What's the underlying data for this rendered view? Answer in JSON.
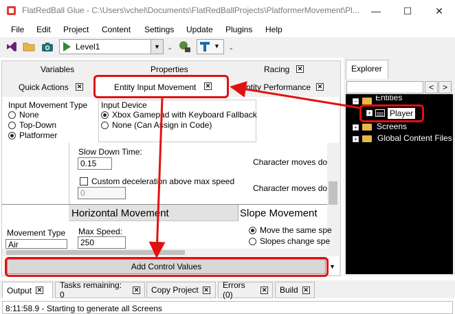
{
  "window": {
    "title": "FlatRedBall Glue - C:\\Users\\vchel\\Documents\\FlatRedBallProjects\\PlatformerMovement\\Pl...",
    "minimize": "—",
    "maximize": "☐",
    "close": "✕"
  },
  "menu": [
    "File",
    "Edit",
    "Project",
    "Content",
    "Settings",
    "Update",
    "Plugins",
    "Help"
  ],
  "toolbar": {
    "level_value": "Level1"
  },
  "tabs": {
    "row1": [
      "Variables",
      "Properties",
      "Racing"
    ],
    "row2": [
      "Quick Actions",
      "Entity Input Movement",
      "Entity Performance"
    ],
    "close_glyph": "✕"
  },
  "input_movement": {
    "title": "Input Movement Type",
    "options": [
      "None",
      "Top-Down",
      "Platformer"
    ],
    "selected": "Platformer"
  },
  "input_device": {
    "title": "Input Device",
    "options": [
      "Xbox Gamepad with Keyboard Fallback",
      "None (Can Assign in Code)"
    ],
    "selected": "Xbox Gamepad with Keyboard Fallback"
  },
  "settings": {
    "slow_down_label": "Slow Down Time:",
    "slow_down_value": "0.15",
    "custom_decel_label": "Custom deceleration above max speed",
    "custom_decel_value": "0",
    "character_moves_1": "Character moves dov",
    "character_moves_2": "Character moves dov",
    "horizontal_header": "Horizontal Movement",
    "slope_header": "Slope Movement",
    "movement_type_label": "Movement Type",
    "movement_type_value": "Air",
    "max_speed_label": "Max Speed:",
    "max_speed_value": "250",
    "slope_option_1": "Move the same spe",
    "slope_option_2": "Slopes change spe"
  },
  "add_button": "Add Control Values",
  "explorer": {
    "tab": "Explorer",
    "nav_back": "<",
    "nav_forward": ">",
    "items": [
      "Entities",
      "Player",
      "Screens",
      "Global Content Files"
    ]
  },
  "bottom_tabs": [
    "Output",
    "Tasks remaining: 0",
    "Copy Project",
    "Errors (0)",
    "Build"
  ],
  "output_text": "8:11:58.9 - Starting to generate all Screens",
  "colors": {
    "highlight": "#e31010",
    "tree_bg": "#000000",
    "header_bg": "#e2e2e2"
  }
}
